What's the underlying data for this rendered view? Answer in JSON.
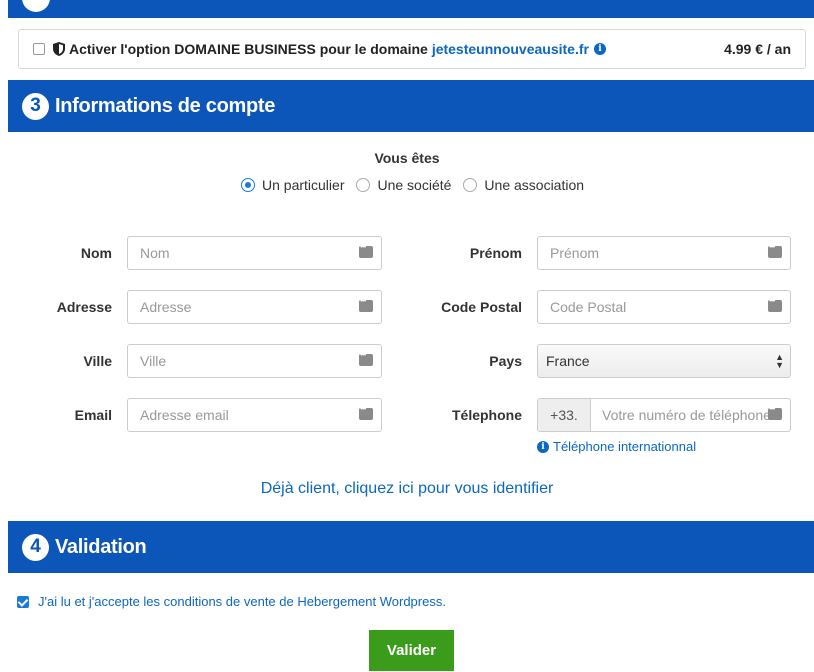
{
  "domain_option": {
    "label": "Activer l'option DOMAINE BUSINESS pour le domaine",
    "domain": "jetesteunnouveausite.fr",
    "price": "4.99 € / an",
    "checked": false
  },
  "section3": {
    "number": "3",
    "title": "Informations de compte"
  },
  "account_type": {
    "title": "Vous êtes",
    "options": [
      {
        "label": "Un particulier",
        "selected": true
      },
      {
        "label": "Une société",
        "selected": false
      },
      {
        "label": "Une association",
        "selected": false
      }
    ]
  },
  "form": {
    "nom": {
      "label": "Nom",
      "placeholder": "Nom"
    },
    "prenom": {
      "label": "Prénom",
      "placeholder": "Prénom"
    },
    "adresse": {
      "label": "Adresse",
      "placeholder": "Adresse"
    },
    "code_postal": {
      "label": "Code Postal",
      "placeholder": "Code Postal"
    },
    "ville": {
      "label": "Ville",
      "placeholder": "Ville"
    },
    "pays": {
      "label": "Pays",
      "value": "France"
    },
    "email": {
      "label": "Email",
      "placeholder": "Adresse email"
    },
    "telephone": {
      "label": "Télephone",
      "prefix": "+33.",
      "placeholder": "Votre numéro de téléphone"
    },
    "intl_link": "Téléphone internationnal"
  },
  "client_link": "Déjà client, cliquez ici pour vous identifier",
  "section4": {
    "number": "4",
    "title": "Validation"
  },
  "accept_terms": {
    "label": "J'ai lu et j'accepte les conditions de vente de Hebergement Wordpress.",
    "checked": true
  },
  "submit_label": "Valider",
  "colors": {
    "section_bar": "#0b56b8",
    "link": "#0b67c2",
    "submit": "#3b9b1a"
  }
}
